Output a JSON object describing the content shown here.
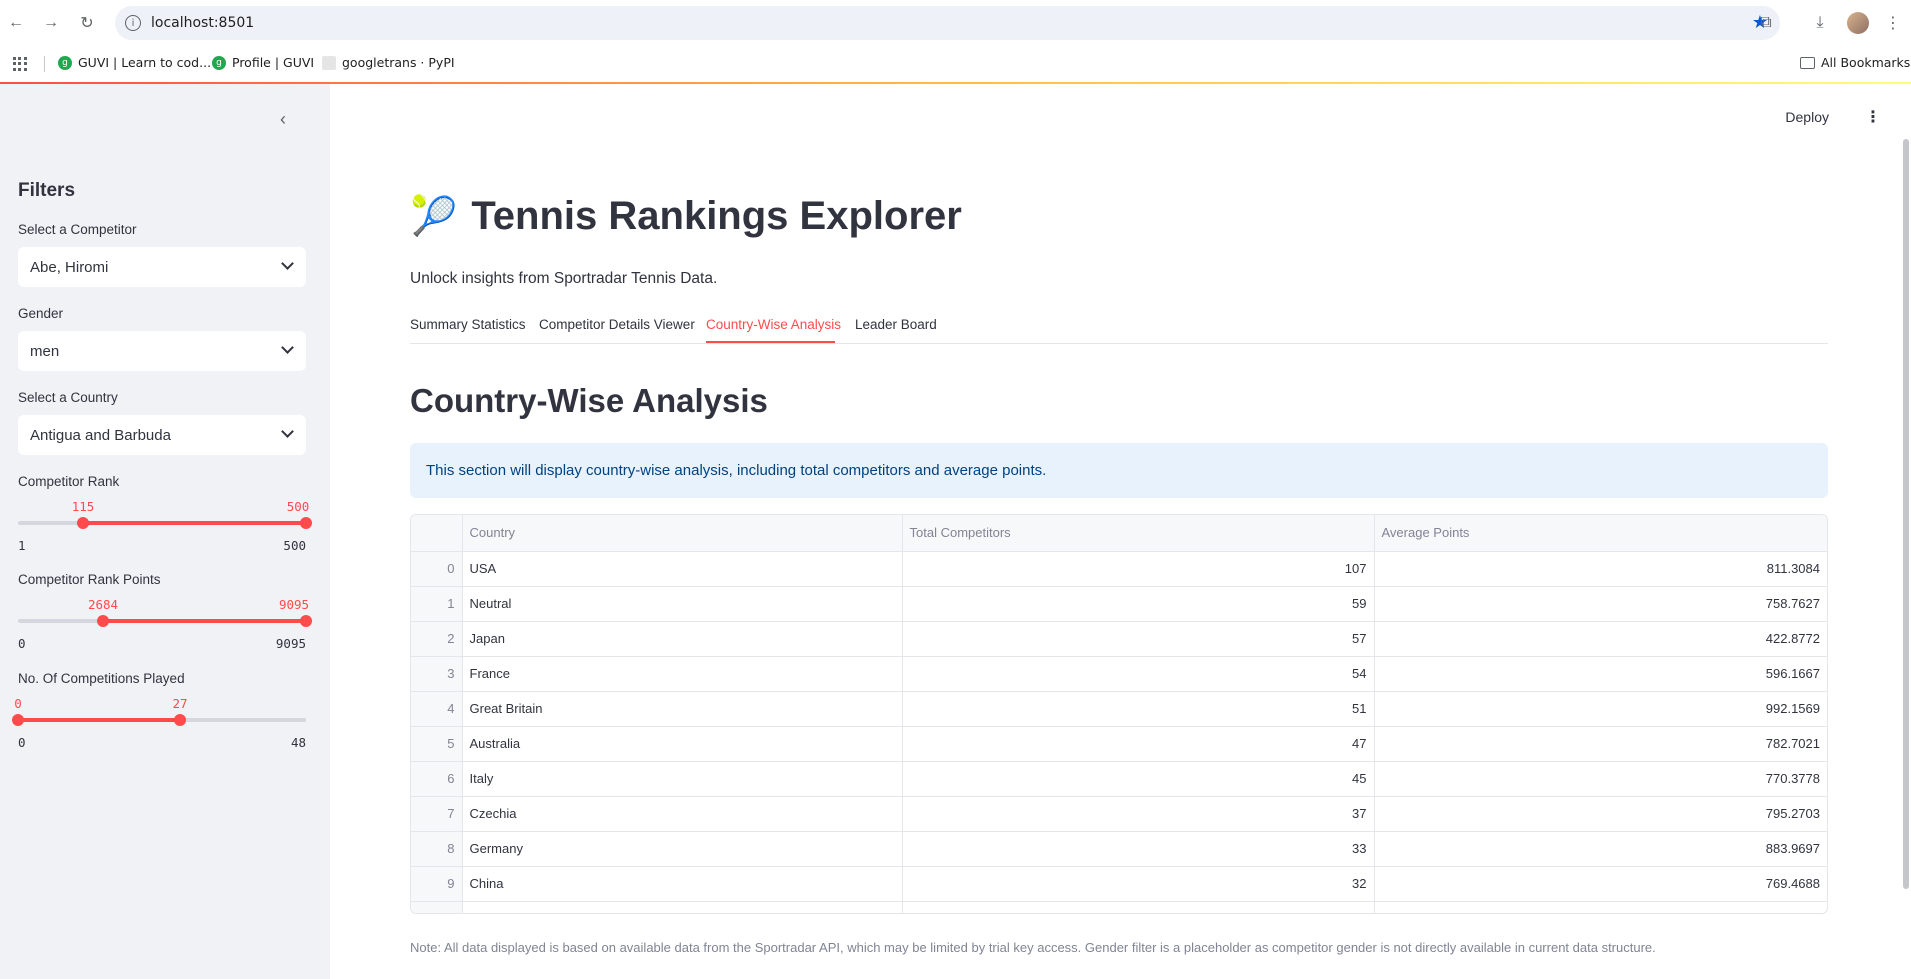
{
  "browser": {
    "url": "localhost:8501",
    "bookmarks": [
      {
        "label": "GUVI | Learn to cod..."
      },
      {
        "label": "Profile | GUVI"
      },
      {
        "label": "googletrans · PyPI"
      }
    ],
    "all_bookmarks": "All Bookmarks"
  },
  "sidebar": {
    "title": "Filters",
    "competitor_label": "Select a Competitor",
    "competitor_value": "Abe, Hiromi",
    "gender_label": "Gender",
    "gender_value": "men",
    "country_label": "Select a Country",
    "country_value": "Antigua and Barbuda",
    "rank_slider": {
      "label": "Competitor Rank",
      "low": "115",
      "high": "500",
      "min": "1",
      "max": "500"
    },
    "points_slider": {
      "label": "Competitor Rank Points",
      "low": "2684",
      "high": "9095",
      "min": "0",
      "max": "9095"
    },
    "competitions_slider": {
      "label": "No. Of Competitions Played",
      "low": "0",
      "high": "27",
      "min": "0",
      "max": "48"
    }
  },
  "header": {
    "deploy_label": "Deploy"
  },
  "main": {
    "title": "Tennis Rankings Explorer",
    "subtitle": "Unlock insights from Sportradar Tennis Data.",
    "tabs": [
      {
        "label": "Summary Statistics"
      },
      {
        "label": "Competitor Details Viewer"
      },
      {
        "label": "Country-Wise Analysis"
      },
      {
        "label": "Leader Board"
      }
    ],
    "active_tab": "Country-Wise Analysis",
    "section_title": "Country-Wise Analysis",
    "info_text": "This section will display country-wise analysis, including total competitors and average points.",
    "table": {
      "columns": [
        "Country",
        "Total Competitors",
        "Average Points"
      ],
      "rows": [
        {
          "idx": "0",
          "country": "USA",
          "total": "107",
          "avg": "811.3084"
        },
        {
          "idx": "1",
          "country": "Neutral",
          "total": "59",
          "avg": "758.7627"
        },
        {
          "idx": "2",
          "country": "Japan",
          "total": "57",
          "avg": "422.8772"
        },
        {
          "idx": "3",
          "country": "France",
          "total": "54",
          "avg": "596.1667"
        },
        {
          "idx": "4",
          "country": "Great Britain",
          "total": "51",
          "avg": "992.1569"
        },
        {
          "idx": "5",
          "country": "Australia",
          "total": "47",
          "avg": "782.7021"
        },
        {
          "idx": "6",
          "country": "Italy",
          "total": "45",
          "avg": "770.3778"
        },
        {
          "idx": "7",
          "country": "Czechia",
          "total": "37",
          "avg": "795.2703"
        },
        {
          "idx": "8",
          "country": "Germany",
          "total": "33",
          "avg": "883.9697"
        },
        {
          "idx": "9",
          "country": "China",
          "total": "32",
          "avg": "769.4688"
        }
      ]
    },
    "note": "Note: All data displayed is based on available data from the Sportradar API, which may be limited by trial key access. Gender filter is a placeholder as competitor gender is not directly available in current data structure."
  },
  "colors": {
    "accent": "#ff4b4b",
    "info_bg": "#e8f2fc",
    "info_text": "#004280",
    "sidebar_bg": "#f0f2f6"
  }
}
